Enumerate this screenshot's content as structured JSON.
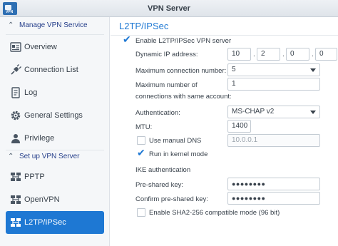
{
  "window": {
    "title": "VPN Server",
    "icon_label": "VPN"
  },
  "sidebar": {
    "manage_section": "Manage VPN Service",
    "setup_section": "Set up VPN Server",
    "items": [
      {
        "label": "Overview",
        "icon": "overview-icon"
      },
      {
        "label": "Connection List",
        "icon": "plug-icon"
      },
      {
        "label": "Log",
        "icon": "log-icon"
      },
      {
        "label": "General Settings",
        "icon": "gear-icon"
      },
      {
        "label": "Privilege",
        "icon": "user-icon"
      }
    ],
    "servers": [
      {
        "label": "PPTP",
        "icon": "network-icon"
      },
      {
        "label": "OpenVPN",
        "icon": "network-icon"
      },
      {
        "label": "L2TP/IPSec",
        "icon": "network-icon",
        "selected": true
      }
    ]
  },
  "panel": {
    "title": "L2TP/IPSec",
    "enable": {
      "label": "Enable L2TP/IPSec VPN server",
      "checked": true
    },
    "dynamic_ip": {
      "label": "Dynamic IP address:",
      "octets": [
        "10",
        "2",
        "0",
        "0"
      ]
    },
    "max_conn": {
      "label": "Maximum connection number:",
      "value": "5"
    },
    "max_per_account": {
      "label_line1": "Maximum number of",
      "label_line2": "connections with same account:",
      "value": "1"
    },
    "auth": {
      "label": "Authentication:",
      "value": "MS-CHAP v2"
    },
    "mtu": {
      "label": "MTU:",
      "value": "1400"
    },
    "manual_dns": {
      "label": "Use manual DNS",
      "checked": false,
      "value": "10.0.0.1"
    },
    "kernel_mode": {
      "label": "Run in kernel mode",
      "checked": true
    },
    "ike_heading": "IKE authentication",
    "psk": {
      "label": "Pre-shared key:",
      "value": "●●●●●●●●"
    },
    "confirm_psk": {
      "label": "Confirm pre-shared key:",
      "value": "●●●●●●●●"
    },
    "sha2": {
      "label": "Enable SHA2-256 compatible mode (96 bit)",
      "checked": false
    }
  },
  "colors": {
    "accent": "#1e78d3",
    "section_text": "#27408b"
  }
}
